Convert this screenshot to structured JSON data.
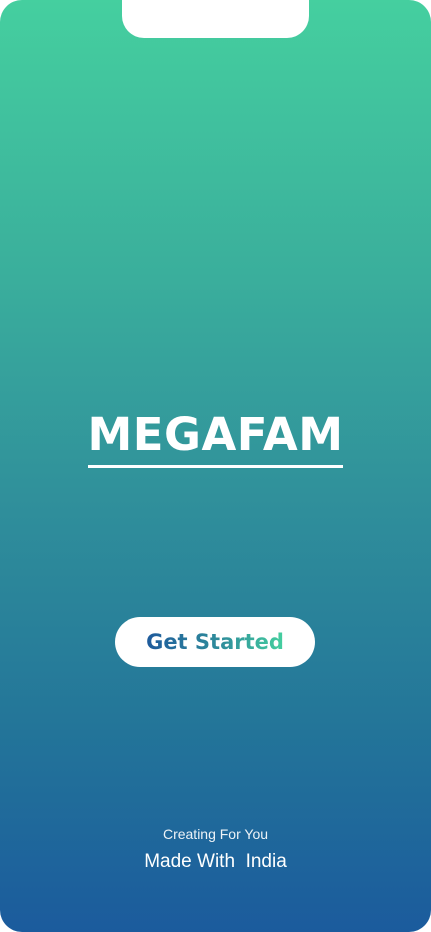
{
  "brand": {
    "title": "MEGAFAM"
  },
  "cta": {
    "label": "Get Started"
  },
  "footer": {
    "tagline": "Creating For You",
    "made_with": "Made With  India"
  },
  "colors": {
    "gradient_top": "#45cf9f",
    "gradient_bottom": "#1b5b9d",
    "button_bg": "#ffffff",
    "text": "#ffffff"
  }
}
